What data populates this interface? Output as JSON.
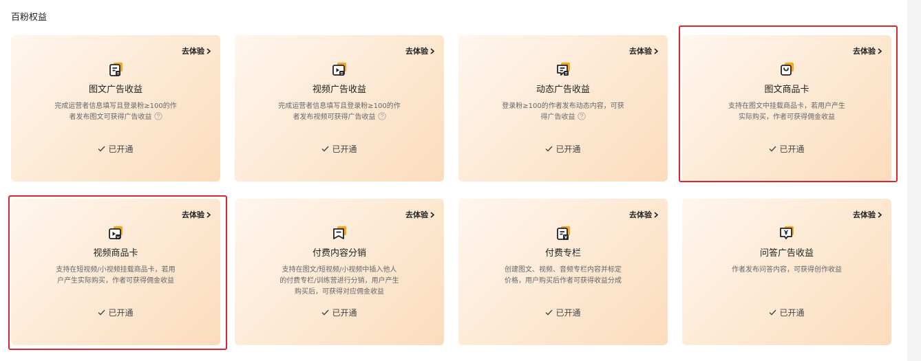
{
  "section_title": "百粉权益",
  "colors": {
    "accent": "#f5a623",
    "highlight": "#e0242b"
  },
  "cards": [
    {
      "icon": "doc-list-icon",
      "try_label": "去体验",
      "title": "图文广告收益",
      "desc_1": "完成运营者信息填写且登录粉≥100的作",
      "desc_2": "者发布图文可获得广告收益",
      "desc_3": "",
      "status": "已开通",
      "highlighted": false
    },
    {
      "icon": "video-doc-icon",
      "try_label": "去体验",
      "title": "视频广告收益",
      "desc_1": "完成运营者信息填写且登录粉≥100的作",
      "desc_2": "者发布视频可获得广告收益",
      "desc_3": "",
      "status": "已开通",
      "highlighted": false
    },
    {
      "icon": "message-list-icon",
      "try_label": "去体验",
      "title": "动态广告收益",
      "desc_1": "登录粉≥100的作者发布动态内容，可获",
      "desc_2": "得广告收益",
      "desc_3": "",
      "status": "已开通",
      "highlighted": false
    },
    {
      "icon": "shopping-bag-icon",
      "try_label": "去体验",
      "title": "图文商品卡",
      "desc_1": "支持在图文中挂载商品卡，若用户产生",
      "desc_2": "实际购买，作者可获得佣金收益",
      "desc_3": "",
      "status": "已开通",
      "highlighted": true
    },
    {
      "icon": "video-product-icon",
      "try_label": "去体验",
      "title": "视频商品卡",
      "desc_1": "支持在短视频/小视频挂载商品卡，若用",
      "desc_2": "户产生实际购买，作者可获得佣金收益",
      "desc_3": "",
      "status": "已开通",
      "highlighted": true
    },
    {
      "icon": "bookmark-icon",
      "try_label": "去体验",
      "title": "付费内容分销",
      "desc_1": "支持在图文/短视频/小视频中插入他人",
      "desc_2": "的付费专栏/训练营进行分销，用户产生",
      "desc_3": "购买后，可获得对应佣金收益",
      "status": "已开通",
      "highlighted": false
    },
    {
      "icon": "yen-doc-icon",
      "try_label": "去体验",
      "title": "付费专栏",
      "desc_1": "创建图文、视频、音频专栏内容并标定",
      "desc_2": "价格，用户购买后作者可获得收益分成",
      "desc_3": "",
      "status": "已开通",
      "highlighted": false
    },
    {
      "icon": "yen-chat-icon",
      "try_label": "去体验",
      "title": "问答广告收益",
      "desc_1": "作者发布问答内容，可获得创作收益",
      "desc_2": "",
      "desc_3": "",
      "status": "已开通",
      "highlighted": false
    }
  ]
}
